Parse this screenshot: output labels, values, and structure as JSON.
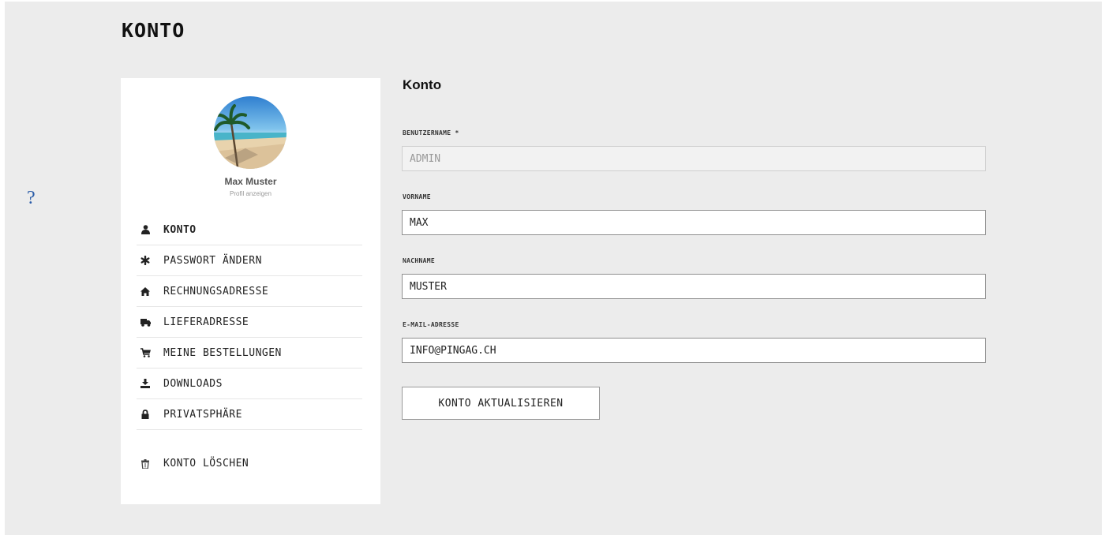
{
  "help": {
    "symbol": "?"
  },
  "page": {
    "title": "KONTO"
  },
  "profile": {
    "name": "Max Muster",
    "link": "Profil anzeigen"
  },
  "nav": {
    "items": [
      {
        "label": "KONTO",
        "icon": "user-icon",
        "active": true
      },
      {
        "label": "PASSWORT ÄNDERN",
        "icon": "asterisk-icon"
      },
      {
        "label": "RECHNUNGSADRESSE",
        "icon": "home-icon"
      },
      {
        "label": "LIEFERADRESSE",
        "icon": "truck-icon"
      },
      {
        "label": "MEINE BESTELLUNGEN",
        "icon": "cart-icon"
      },
      {
        "label": "DOWNLOADS",
        "icon": "download-icon"
      },
      {
        "label": "PRIVATSPHÄRE",
        "icon": "lock-icon"
      }
    ],
    "delete": {
      "label": "KONTO LÖSCHEN",
      "icon": "trash-icon"
    }
  },
  "form": {
    "title": "Konto",
    "username": {
      "label": "BENUTZERNAME *",
      "value": "ADMIN",
      "disabled": true
    },
    "firstname": {
      "label": "VORNAME",
      "value": "MAX"
    },
    "lastname": {
      "label": "NACHNAME",
      "value": "MUSTER"
    },
    "email": {
      "label": "E-MAIL-ADRESSE",
      "value": "INFO@PINGAG.CH"
    },
    "submit_label": "KONTO AKTUALISIEREN"
  }
}
